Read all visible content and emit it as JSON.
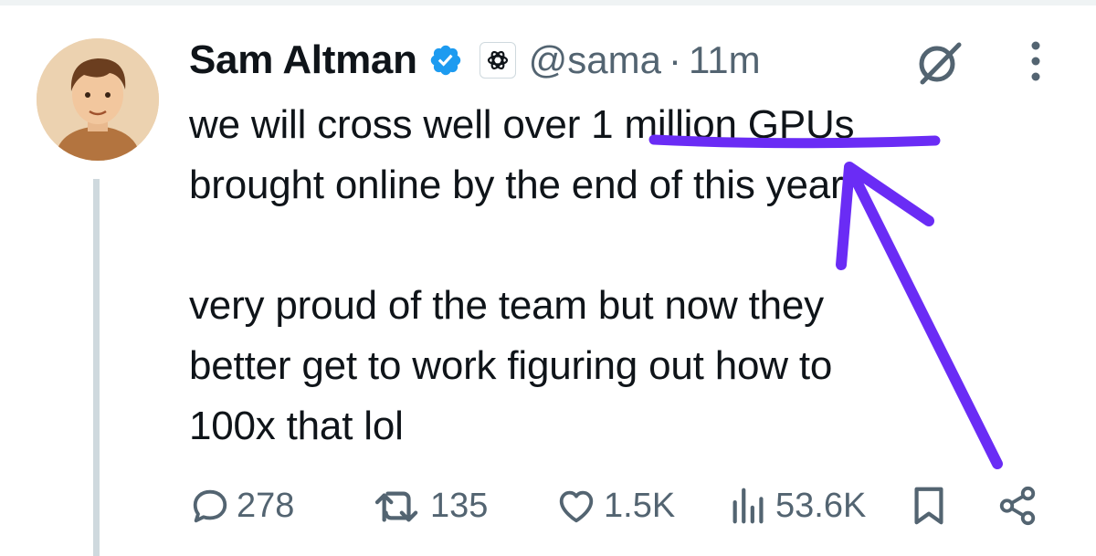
{
  "tweet": {
    "author_name": "Sam Altman",
    "handle": "@sama",
    "separator": "·",
    "time": "11m",
    "text_lines_1": [
      "we will cross well over 1 million GPUs",
      "brought online by the end of this year!"
    ],
    "text_lines_2": [
      "very proud of the team but now they",
      "better get to work figuring out how to",
      "100x that lol"
    ]
  },
  "stats": {
    "replies": "278",
    "reposts": "135",
    "likes": "1.5K",
    "views": "53.6K"
  },
  "icons": {
    "verified": "verified-badge-icon",
    "affiliation": "openai-logo-icon",
    "grok": "grok-icon",
    "more": "more-vertical-icon",
    "reply": "reply-icon",
    "repost": "repost-icon",
    "like": "heart-icon",
    "views": "views-icon",
    "bookmark": "bookmark-icon",
    "share": "share-icon"
  },
  "colors": {
    "text": "#0f1419",
    "secondary": "#536471",
    "verified": "#1d9bf0",
    "annotation": "#6a2cf5"
  }
}
